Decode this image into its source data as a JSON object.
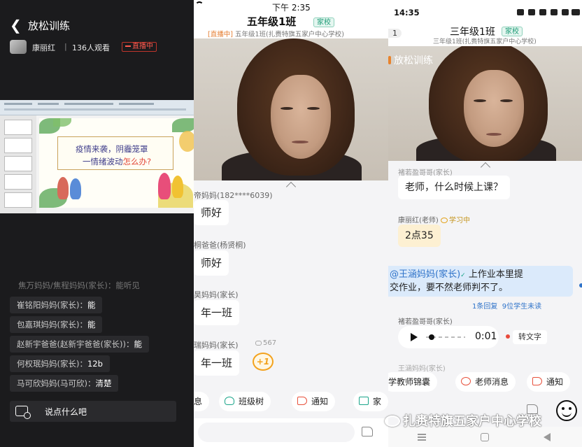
{
  "panel1": {
    "title": "放松训练",
    "host": "康丽红",
    "separator": "|",
    "viewers": "136人观看",
    "live_badge": "直播中",
    "slide_line1": "疫情来袭，阴霾笼罩",
    "slide_line2a": "一情绪波动",
    "slide_line2b": "怎么办?",
    "messages": [
      {
        "name": "焦万妈妈/焦程妈妈(家长)：",
        "text": "能听见"
      },
      {
        "name": "崔铭阳妈妈(家长)：",
        "text": "能"
      },
      {
        "name": "包嘉琪妈妈(家长)：",
        "text": "能"
      },
      {
        "name": "赵新宇爸爸(赵新宇爸爸(家长))：",
        "text": "能"
      },
      {
        "name": "何权珉妈妈(家长)：",
        "text": "12b"
      },
      {
        "name": "马可欣妈妈(马可欣)：",
        "text": "清楚"
      }
    ],
    "say_placeholder": "说点什么吧"
  },
  "panel2": {
    "time": "下午 2:35",
    "class_name": "五年级1班",
    "badge": "家校",
    "live_tag": "[直播中]",
    "subtitle": "五年级1班(扎赉特旗五家户中心学校)",
    "messages": [
      {
        "name": "帝妈妈(182****6039)",
        "text": "师好"
      },
      {
        "name": "桐爸爸(杨贤桐)",
        "text": "师好"
      },
      {
        "name": "昊妈妈(家长)",
        "text": "年一班"
      },
      {
        "name": "瑞妈妈(家长)",
        "text": "年一班"
      }
    ],
    "reply_count": "567",
    "plus_one": "+1",
    "tabs": [
      "息",
      "班级树",
      "通知",
      "家"
    ]
  },
  "panel3": {
    "time": "14:35",
    "back_count": "1",
    "class_name": "三年级1班",
    "badge": "家校",
    "subtitle": "三年级1班(扎赉特旗五家户中心学校)",
    "overlay_title": "放松训练",
    "partial_name": "褚若盈哥哥(家长)",
    "q_text": "老师，什么时候上课？",
    "teacher_name": "康丽红(老师)",
    "learning": "学习中",
    "teacher_reply": "2点35",
    "at_name": "@王涵妈妈(家长)",
    "notice_line1": "上作业本里提",
    "notice_line2": "交作业，要不然老师判不了。",
    "replies": "1条回复",
    "unread": "9位学生未读",
    "voice_sender": "褚若盈哥哥(家长)",
    "voice_duration": "0:01",
    "to_text": "转文字",
    "partial_name2": "王涵妈妈(家长)",
    "tabs": [
      "学教师锦囊",
      "老师消息",
      "通知"
    ]
  },
  "watermark": "扎赉特旗五家户中心学校"
}
